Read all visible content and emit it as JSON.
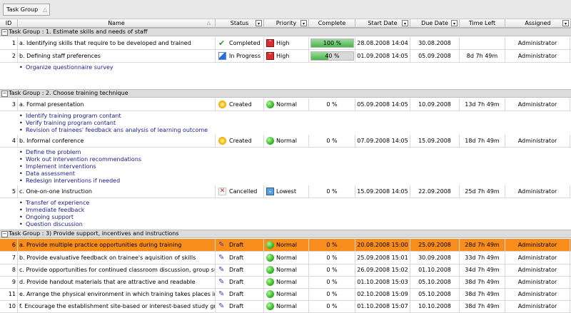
{
  "group_panel": {
    "chip_label": "Task Group",
    "chip_remove": "△"
  },
  "columns": {
    "id": "ID",
    "name": "Name",
    "status": "Status",
    "priority": "Priority",
    "complete": "Complete",
    "start": "Start Date",
    "due": "Due Date",
    "time_left": "Time Left",
    "assigned": "Assigned",
    "dropdown_glyph": "▾",
    "sort_glyph": "△"
  },
  "groups": [
    {
      "label": "Task Group : 1. Estimate skills and needs of staff",
      "toggle": "−"
    },
    {
      "label": "Task Group : 2. Choose training technique",
      "toggle": "−"
    },
    {
      "label": "Task Group : 3) Provide support, incentives and instructions",
      "toggle": "−"
    }
  ],
  "bullet": "•",
  "tasks": [
    {
      "id": "1",
      "name": "a. Identifying skills that require to be developed and trained",
      "status": "Completed",
      "status_icon": "check-icon",
      "priority": "High",
      "priority_icon": "high-priority-icon",
      "complete": "100 %",
      "progress": 1.0,
      "start": "28.08.2008 14:04",
      "due": "30.08.2008",
      "time_left": "",
      "assigned": "Administrator",
      "subtasks": []
    },
    {
      "id": "2",
      "name": "b. Defining staff preferences",
      "status": "In Progress",
      "status_icon": "progress-icon",
      "priority": "High",
      "priority_icon": "high-priority-icon",
      "complete": "40 %",
      "progress": 0.4,
      "start": "01.09.2008 14:05",
      "due": "05.09.2008",
      "time_left": "8d 7h 49m",
      "assigned": "Administrator",
      "subtasks": [
        "Organize questionnaire survey"
      ]
    },
    {
      "id": "3",
      "name": "a. Formal presentation",
      "status": "Created",
      "status_icon": "created-icon",
      "priority": "Normal",
      "priority_icon": "normal-priority-icon",
      "complete": "0 %",
      "start": "05.09.2008 14:05",
      "due": "10.09.2008",
      "time_left": "13d 7h 49m",
      "assigned": "Administrator",
      "subtasks": [
        "Identify training program contant",
        "Verify training program contant",
        "Revision of trainees' feedback ans analysis of learning outcome"
      ]
    },
    {
      "id": "4",
      "name": "b. Informal conference",
      "status": "Created",
      "status_icon": "created-icon",
      "priority": "Normal",
      "priority_icon": "normal-priority-icon",
      "complete": "0 %",
      "start": "07.09.2008 14:05",
      "due": "15.09.2008",
      "time_left": "18d 7h 49m",
      "assigned": "Administrator",
      "subtasks": [
        "Define the problem",
        "Work out intervention recommendations",
        "Implement interventions",
        "Data assessment",
        "Redesign interventions if needed"
      ]
    },
    {
      "id": "5",
      "name": "c. One-on-one instruction",
      "status": "Cancelled",
      "status_icon": "cancel-icon",
      "priority": "Lowest",
      "priority_icon": "lowest-priority-icon",
      "complete": "0 %",
      "start": "15.09.2008 14:05",
      "due": "22.09.2008",
      "time_left": "25d 7h 49m",
      "assigned": "Administrator",
      "subtasks": [
        "Transfer of experience",
        "Immediate feedback",
        "Ongoing support",
        "Question discussion"
      ]
    },
    {
      "id": "6",
      "name": "a. Provide multiple practice opportunities during training",
      "status": "Draft",
      "status_icon": "draft-icon",
      "priority": "Normal",
      "priority_icon": "normal-priority-icon",
      "complete": "0 %",
      "start": "20.08.2008 15:00",
      "due": "25.09.2008",
      "time_left": "28d 7h 49m",
      "assigned": "Administrator",
      "selected": true,
      "subtasks": []
    },
    {
      "id": "7",
      "name": "b. Provide evaluative feedback on trainee's aquisition of skills",
      "status": "Draft",
      "status_icon": "draft-icon",
      "priority": "Normal",
      "priority_icon": "normal-priority-icon",
      "complete": "0 %",
      "start": "25.09.2008 15:01",
      "due": "30.09.2008",
      "time_left": "33d 7h 49m",
      "assigned": "Administrator",
      "subtasks": []
    },
    {
      "id": "8",
      "name": "c. Provide opportunities for continued classroom discussion, group support",
      "status": "Draft",
      "status_icon": "draft-icon",
      "priority": "Normal",
      "priority_icon": "normal-priority-icon",
      "complete": "0 %",
      "start": "26.09.2008 15:02",
      "due": "01.10.2008",
      "time_left": "34d 7h 49m",
      "assigned": "Administrator",
      "subtasks": []
    },
    {
      "id": "9",
      "name": "d. Provide handout materials that are attractive and readable",
      "status": "Draft",
      "status_icon": "draft-icon",
      "priority": "Normal",
      "priority_icon": "normal-priority-icon",
      "complete": "0 %",
      "start": "01.10.2008 15:03",
      "due": "05.10.2008",
      "time_left": "38d 7h 49m",
      "assigned": "Administrator",
      "subtasks": []
    },
    {
      "id": "11",
      "name": "e. Arrange the physical environment in which training takes places in a way",
      "status": "Draft",
      "status_icon": "draft-icon",
      "priority": "Normal",
      "priority_icon": "normal-priority-icon",
      "complete": "0 %",
      "start": "02.10.2008 15:09",
      "due": "05.10.2008",
      "time_left": "38d 7h 49m",
      "assigned": "Administrator",
      "subtasks": []
    },
    {
      "id": "10",
      "name": "f. Encourage the establishment site-based or interest-based study group to",
      "status": "Draft",
      "status_icon": "draft-icon",
      "priority": "Normal",
      "priority_icon": "normal-priority-icon",
      "complete": "0 %",
      "start": "01.10.2008 15:07",
      "due": "10.10.2008",
      "time_left": "38d 7h 49m",
      "assigned": "Administrator",
      "subtasks": []
    }
  ],
  "colors": {
    "selected_row": "#f98d1b",
    "progress_fill": "#4cb24c",
    "group_header": "#dcdcdc",
    "subtask_link": "#1a1a8c"
  }
}
